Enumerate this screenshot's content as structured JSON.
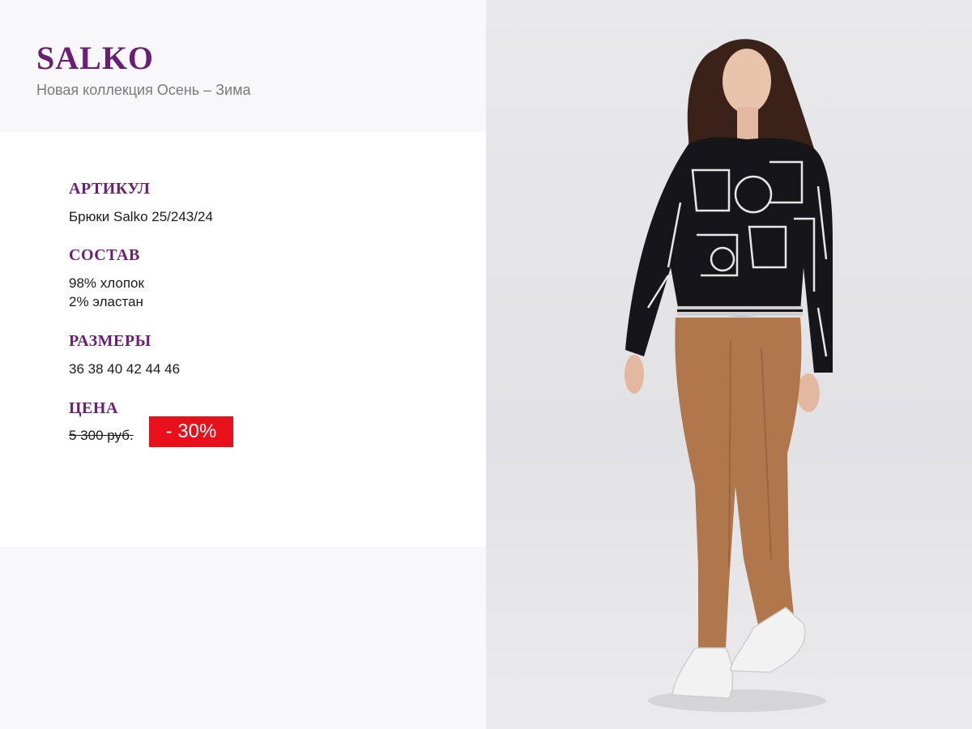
{
  "header": {
    "brand": "SALKO",
    "subtitle": "Новая коллекция Осень – Зима"
  },
  "details": {
    "article_label": "АРТИКУЛ",
    "article_value": "Брюки Salko 25/243/24",
    "composition_label": "СОСТАВ",
    "composition_lines": [
      "98% хлопок",
      "2% эластан"
    ],
    "sizes_label": "РАЗМЕРЫ",
    "sizes_value": "36 38 40 42 44 46",
    "price_label": "ЦЕНА",
    "old_price": "5 300 руб.",
    "discount": "- 30%"
  },
  "colors": {
    "brand_purple": "#6a1f73",
    "discount_red": "#e8101a"
  },
  "photo": {
    "description_icon": "model-photo"
  }
}
